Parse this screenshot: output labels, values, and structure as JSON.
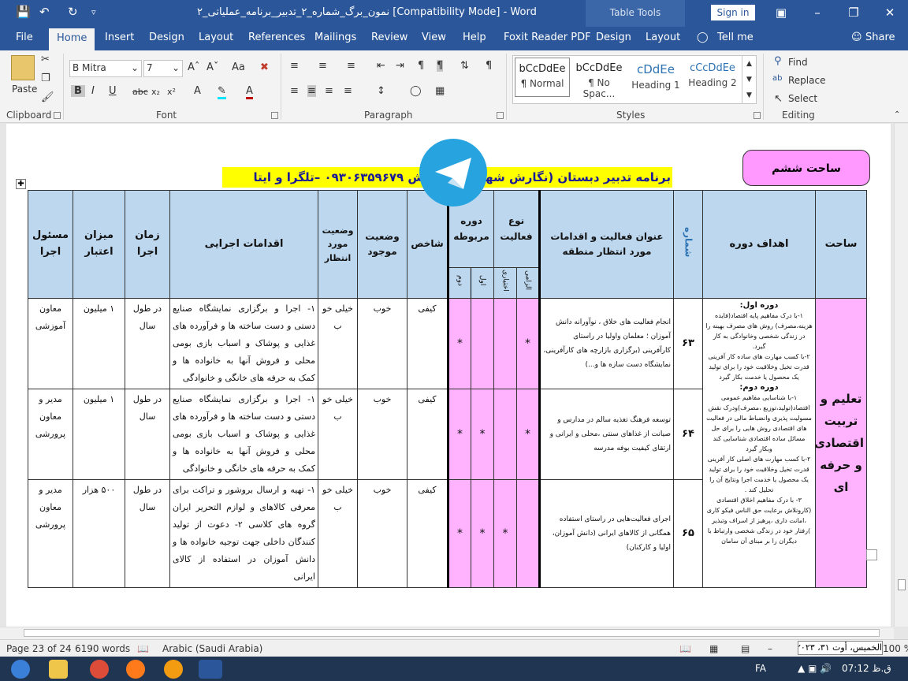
{
  "window": {
    "title": "نمون_برگ_شماره_۲_تدبیر_برنامه_عملیاتی_۲ [Compatibility Mode]  -  Word",
    "table_tools": "Table Tools",
    "sign_in": "Sign in"
  },
  "tabs": [
    "File",
    "Home",
    "Insert",
    "Design",
    "Layout",
    "References",
    "Mailings",
    "Review",
    "View",
    "Help",
    "Foxit Reader PDF",
    "Design",
    "Layout",
    "Tell me",
    "Share"
  ],
  "ribbon": {
    "paste": "Paste",
    "font_name": "B Mitra",
    "font_size": "7",
    "groups": {
      "clipboard": "Clipboard",
      "font": "Font",
      "paragraph": "Paragraph",
      "styles": "Styles",
      "editing": "Editing"
    },
    "styles": [
      {
        "preview": "bCcDdEe",
        "name": "¶ Normal"
      },
      {
        "preview": "bCcDdEe",
        "name": "¶ No Spac..."
      },
      {
        "preview": "cDdEe",
        "name": "Heading 1"
      },
      {
        "preview": "cCcDdEe",
        "name": "Heading 2"
      }
    ],
    "find": "Find",
    "replace": "Replace",
    "select": "Select"
  },
  "document": {
    "grade_label": "ساحت ششم",
    "program_title": "برنامه تدبیر دبستان (نگارش شهریور  سفارش ۰۹۳۰۶۳۵۹۶۷۹ –تلگرا و ایتا",
    "headers": {
      "sahat": "ساحت",
      "goals": "اهداف دوره",
      "number": "شماره",
      "activity_title": "عنوان فعالیت و اقدامات مورد انتظار منطقه",
      "activity_type": "نوع فعالیت",
      "type_required": "الزامی",
      "type_optional": "اختیاری",
      "related_period": "دوره مربوطه",
      "period_first": "اول",
      "period_second": "دوم",
      "indicator": "شاخص",
      "current_status": "وضعیت موجود",
      "expected_status": "وضعیت مورد انتظار",
      "actions": "اقدامات اجرایی",
      "time": "زمان اجرا",
      "budget": "میزان اعتبار",
      "responsible": "مسئول اجرا"
    },
    "sahat_value": "تعلیم و تربیت اقتصادی و حرفه ای",
    "goals_text": {
      "p1_title": "دوره اول:",
      "p1_a": "۱-با درک مفاهیم پایه اقتصاد(فایده هزینه،مصرف) روش های مصرف بهینه را در زندگی شخصی وخانوادگی به کار گیرد.",
      "p1_b": "۲-با کسب مهارت های ساده کار آفرینی قدرت تخیل وخلاقیت خود را برای تولید یک محصول یا خدمت بکار گیرد",
      "p2_title": "دوره دوم:",
      "p2_a": "۱-با شناسایی مفاهیم عمومی اقتصاد(تولید،توزیع ،مصرف)ودرک نقش مسولیت پذیری وانضباط مالی در فعالیت های اقتصادی روش هایی را برای حل مسائل ساده اقتصادی شناسایی کند وبکار گیرد",
      "p2_b": "۲-با کسب مهارت های اصلی کار آفرینی قدرت تخیل وخلاقیت خود را برای تولید یک محصول یا خدمت اجرا ونتایج آن را تحلیل کند .",
      "p2_c": "۳- با درک مفاهیم اخلاق اقتصادی (کارونلاش برعایت حق الناس فیکو کاری ،امانت داری ،پرهیز از اسراف وتبذیر )رفتار خود در زندگی شخصی وارتباط با دیگران را بر مبنای آن سامان"
    },
    "rows": [
      {
        "number": "۶۳",
        "title": "انجام فعالیت های خلاق ، نوآورانه دانش آموزان ؛ معلمان واولیا در راستای کارآفرینی (برگزاری بازارچه های کارآفرینی، نمایشگاه دست سازه ها و...)",
        "required": "*",
        "optional": "",
        "first": "",
        "second": "*",
        "indicator": "کیفی",
        "current": "خوب",
        "expected": "خیلی خو ب",
        "actions": "۱- اجرا و برگزاری نمایشگاه صنایع دستی و دست ساخته ها و فرآورده های غذایی و پوشاک و اسباب بازی بومی محلی و فروش آنها به خانواده ها و کمک به حرفه های خانگی و خانوادگی",
        "time": "در طول سال",
        "budget": "۱ میلیون",
        "responsible": "معاون آموزشی"
      },
      {
        "number": "۶۴",
        "title": "توسعه فرهنگ تغذیه سالم در مدارس و صیانت از غذاهای سنتی ،محلی و ایرانی و ارتقای کیفیت بوفه مدرسه",
        "required": "*",
        "optional": "",
        "first": "*",
        "second": "*",
        "indicator": "کیفی",
        "current": "خوب",
        "expected": "خیلی خو ب",
        "actions": "۱- اجرا و برگزاری نمایشگاه صنایع دستی و دست ساخته ها و فرآورده های غذایی و پوشاک و اسباب بازی بومی محلی و فروش آنها به خانواده ها و کمک به حرفه های خانگی و خانوادگی",
        "time": "در طول سال",
        "budget": "۱ میلیون",
        "responsible": "مدیر و معاون پرورشی"
      },
      {
        "number": "۶۵",
        "title": "اجرای فعالیت‌هایی در راستای استفاده همگانی از کالاهای ایرانی (دانش آموزان، اولیا و کارکنان)",
        "required": "",
        "optional": "*",
        "first": "*",
        "second": "*",
        "indicator": "کیفی",
        "current": "خوب",
        "expected": "خیلی خو ب",
        "actions": "۱- تهیه و ارسال بروشور و تراکت برای معرفی کالاهای و لوازم التحریر ایران گروه های کلاسی ۲- دعوت از تولید کنندگان داخلی جهت توجیه خانواده ها و دانش آموزان در استفاده از کالای ایرانی",
        "time": "در طول سال",
        "budget": "۵۰۰ هزار",
        "responsible": "مدیر و معاون پرورشی"
      }
    ]
  },
  "status": {
    "page": "Page 23 of 24",
    "words": "6190 words",
    "language": "Arabic (Saudi Arabia)",
    "zoom": "100 %",
    "date_tooltip": "الخمیس، أوت ۳۱، ۲۰۲۳"
  },
  "taskbar": {
    "lang": "FA",
    "time": "07:12",
    "ampm": "ق.ظ"
  }
}
